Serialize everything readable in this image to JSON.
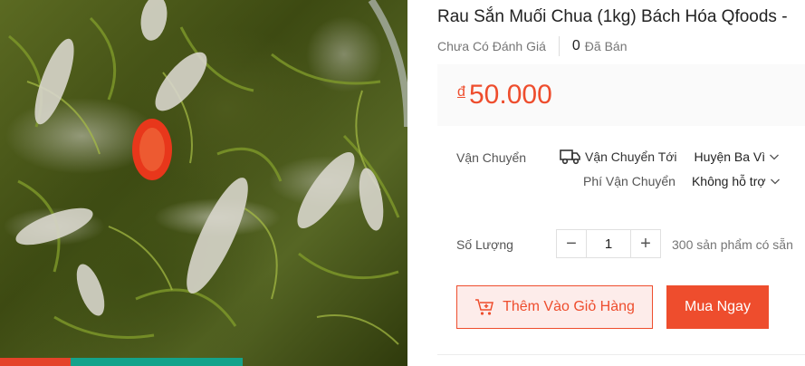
{
  "product": {
    "title": "Rau Sắn Muối Chua (1kg) Bách Hóa Qfoods -",
    "reviews": "Chưa Có Đánh Giá",
    "sold_count": "0",
    "sold_label": "Đã Bán"
  },
  "price": {
    "currency": "đ",
    "value": "50.000"
  },
  "shipping": {
    "label": "Vận Chuyển",
    "to_label": "Vận Chuyển Tới",
    "to_value": "Huyện Ba Vì",
    "fee_label": "Phí Vận Chuyển",
    "fee_value": "Không hỗ trợ",
    "icon": "truck-icon"
  },
  "quantity": {
    "label": "Số Lượng",
    "value": "1",
    "minus": "−",
    "plus": "+",
    "stock": "300 sản phẩm có sẵn"
  },
  "actions": {
    "add_to_cart": "Thêm Vào Giỏ Hàng",
    "buy_now": "Mua Ngay"
  },
  "colors": {
    "accent": "#ee4d2d",
    "accent_light": "#fdecea",
    "strip_red": "#e5432a",
    "strip_teal": "#14a38b"
  }
}
